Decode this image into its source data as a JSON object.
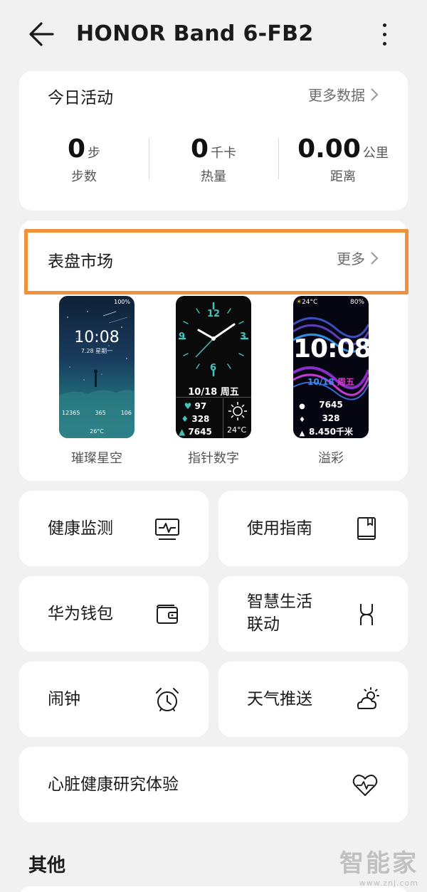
{
  "app_bar": {
    "title": "HONOR Band 6-FB2"
  },
  "activity": {
    "title": "今日活动",
    "more_label": "更多数据",
    "stats": [
      {
        "value": "0",
        "unit": "步",
        "label": "步数"
      },
      {
        "value": "0",
        "unit": "千卡",
        "label": "热量"
      },
      {
        "value": "0.00",
        "unit": "公里",
        "label": "距离"
      }
    ]
  },
  "watch_faces": {
    "title": "表盘市场",
    "more_label": "更多",
    "items": [
      {
        "name": "璀璨星空",
        "battery": "100%",
        "time": "10:08",
        "date": "7.28 星期一",
        "steps": "12365",
        "kcal": "365",
        "heart": "106",
        "temp": "26°C"
      },
      {
        "name": "指针数字",
        "date": "10/18",
        "weekday": "周五",
        "heart": "97",
        "kcal": "328",
        "steps": "7645",
        "temp": "24°C",
        "dial_numbers": [
          "12",
          "3",
          "6",
          "9"
        ]
      },
      {
        "name": "溢彩",
        "temp": "24°C",
        "battery": "80%",
        "time": "10:08",
        "date": "10/18",
        "weekday": "周五",
        "steps": "7645",
        "kcal": "328",
        "distance": "8.450千米"
      }
    ]
  },
  "features": [
    {
      "label": "健康监测",
      "icon": "health-monitor-icon"
    },
    {
      "label": "使用指南",
      "icon": "book-icon"
    },
    {
      "label": "华为钱包",
      "icon": "wallet-icon"
    },
    {
      "label_line1": "智慧生活",
      "label_line2": "联动",
      "icon": "smart-life-icon"
    },
    {
      "label": "闹钟",
      "icon": "alarm-clock-icon"
    },
    {
      "label": "天气推送",
      "icon": "weather-icon"
    },
    {
      "label": "心脏健康研究体验",
      "icon": "heart-pulse-icon"
    }
  ],
  "other_section": {
    "title": "其他"
  },
  "watermark": {
    "text": "智能家",
    "url": "www.znj.com"
  },
  "colors": {
    "highlight": "#f0913a",
    "accent_teal": "#46c2bd",
    "accent_magenta": "#d63cc5",
    "background": "#f1f1f1"
  }
}
